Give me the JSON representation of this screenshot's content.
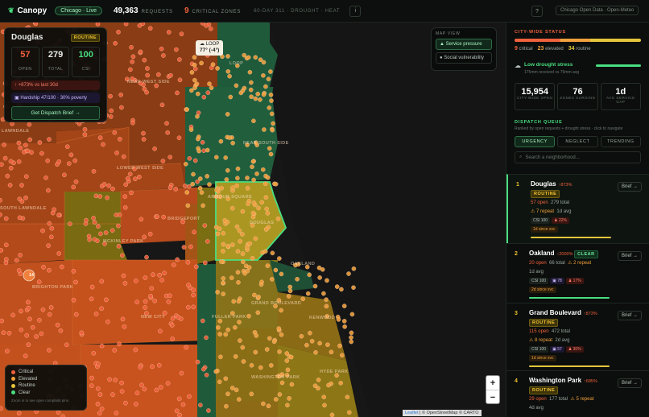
{
  "header": {
    "app_name": "Canopy",
    "live_label": "Chicago · Live",
    "requests_count": "49,363",
    "requests_label": "REQUESTS",
    "critical_count": "9",
    "critical_label": "CRITICAL ZONES",
    "context": "60-DAY 311 · DROUGHT · HEAT",
    "info_icon": "i",
    "help_icon": "?",
    "source": "Chicago Open Data · Open-Meteo"
  },
  "area_card": {
    "name": "Douglas",
    "badge": "ROUTINE",
    "open": "57",
    "open_label": "OPEN",
    "total": "279",
    "total_label": "TOTAL",
    "csi": "100",
    "csi_label": "CSI",
    "change": "↑ +873% vs last 30d",
    "hardship": "Hardship 47/100 · 30% poverty",
    "dispatch_btn": "Get Dispatch Brief →"
  },
  "weather_chip": {
    "name": "LOOP",
    "temp": "77° (-4°)"
  },
  "map_view": {
    "title": "MAP VIEW",
    "options": [
      "Service pressure",
      "Social vulnerability"
    ],
    "active": "Service pressure"
  },
  "map_labels": {
    "near_west_side": "NEAR WEST SIDE",
    "loop": "LOOP",
    "near_south_side": "NEAR SOUTH SIDE",
    "lawndale": "LAWNDALE",
    "lower_west_side": "LOWER WEST SIDE",
    "armour_square": "ARMOUR SQUARE",
    "douglas": "DOUGLAS",
    "south_lawndale": "SOUTH LAWNDALE",
    "bridgeport": "BRIDGEPORT",
    "mckinley_park": "MCKINLEY PARK",
    "oakland": "OAKLAND",
    "brighton_park": "BRIGHTON PARK",
    "grand_boulevard": "GRAND BOULEVARD",
    "new_city": "NEW CITY",
    "fuller_park": "FULLER PARK",
    "kenwood": "KENWOOD",
    "washington_park": "WASHINGTON PARK",
    "hyde_park": "HYDE PARK",
    "cluster_count": "14"
  },
  "legend": {
    "items": [
      {
        "label": "Critical",
        "color": "#f0613d"
      },
      {
        "label": "Elevated",
        "color": "#f0a03d"
      },
      {
        "label": "Routine",
        "color": "#e5c53b"
      },
      {
        "label": "Clear",
        "color": "#4ade80"
      }
    ],
    "note": "Zoom in to see open complaint pins"
  },
  "zoom": {
    "in": "+",
    "out": "−"
  },
  "attribution": {
    "leaflet": "Leaflet",
    "rest": "| © OpenStreetMap © CARTO"
  },
  "city_status": {
    "title": "CITY-WIDE STATUS",
    "critical": "9",
    "critical_label": "critical",
    "elevated": "23",
    "elevated_label": "elevated",
    "routine": "34",
    "routine_label": "routine",
    "drought_title": "Low drought stress",
    "drought_sub": "175mm received vs 75mm avg"
  },
  "summary": [
    {
      "value": "15,954",
      "label": "CITY-WIDE OPEN"
    },
    {
      "value": "76",
      "label": "ZONES SURGING"
    },
    {
      "value": "1d",
      "label": "AVG SERVICE GAP"
    }
  ],
  "queue": {
    "title": "DISPATCH QUEUE",
    "subtitle": "Ranked by open requests + drought stress · click to navigate",
    "tabs": [
      "URGENCY",
      "NEGLECT",
      "TRENDING"
    ],
    "active_tab": "URGENCY",
    "search_placeholder": "Search a neighborhood...",
    "brief_label": "Brief →",
    "items": [
      {
        "rank": "1",
        "name": "Douglas",
        "pct": "↑873%",
        "tag": "ROUTINE",
        "tag_type": "routine",
        "open": "57 open",
        "total": "279 total",
        "repeat": "⚠ 7 repeat",
        "avg": "1d avg",
        "csi": "CSI 100",
        "hardship": "",
        "poverty": "22%",
        "since": "1d since svc",
        "color": "#e5c53b"
      },
      {
        "rank": "2",
        "name": "Oakland",
        "pct": "↑2000%",
        "tag": "CLEAR",
        "tag_type": "clear",
        "open": "20 open",
        "total": "66 total",
        "repeat": "⚠ 2 repeat",
        "avg": "1d avg",
        "csi": "CSI 100",
        "hardship": "78",
        "poverty": "17%",
        "since": "2d since svc",
        "color": "#4ade80"
      },
      {
        "rank": "3",
        "name": "Grand Boulevard",
        "pct": "↑873%",
        "tag": "ROUTINE",
        "tag_type": "routine",
        "open": "115 open",
        "total": "472 total",
        "repeat": "⚠ 8 repeat",
        "avg": "2d avg",
        "csi": "CSI 100",
        "hardship": "57",
        "poverty": "30%",
        "since": "1d since svc",
        "color": "#e5c53b"
      },
      {
        "rank": "4",
        "name": "Washington Park",
        "pct": "↑685%",
        "tag": "ROUTINE",
        "tag_type": "routine",
        "open": "29 open",
        "total": "177 total",
        "repeat": "⚠ 5 repeat",
        "avg": "4d avg",
        "csi": "",
        "hardship": "",
        "poverty": "",
        "since": "",
        "color": "#e5c53b"
      }
    ]
  }
}
